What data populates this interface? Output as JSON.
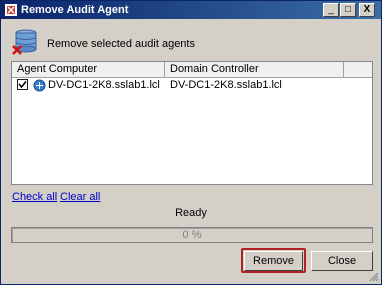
{
  "window": {
    "title": "Remove Audit Agent"
  },
  "title_buttons": {
    "minimize": "_",
    "maximize": "□",
    "close": "X"
  },
  "header": {
    "text": "Remove selected audit agents",
    "icon": "database-remove-icon"
  },
  "list": {
    "columns": [
      "Agent Computer",
      "Domain Controller"
    ],
    "rows": [
      {
        "checked": true,
        "agent_computer": "DV-DC1-2K8.sslab1.lcl",
        "domain_controller": "DV-DC1-2K8.sslab1.lcl"
      }
    ]
  },
  "links": {
    "check_all": "Check all",
    "clear_all": "Clear all"
  },
  "status": "Ready",
  "progress": {
    "value": 0,
    "label": "0 %"
  },
  "buttons": {
    "remove": "Remove",
    "close": "Close"
  },
  "colors": {
    "title_bar": "#0a246a",
    "highlight": "#b22222",
    "link": "#0000cc"
  }
}
